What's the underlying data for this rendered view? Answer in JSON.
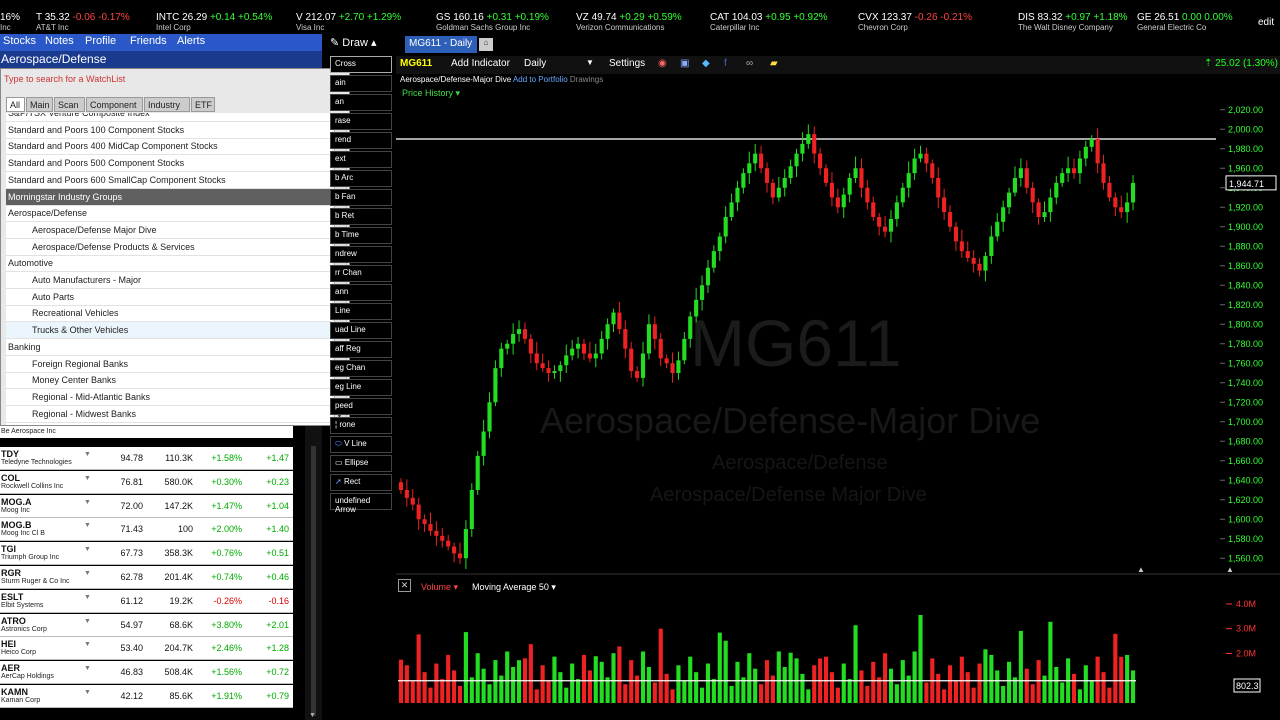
{
  "ticker": [
    {
      "sym": "16%",
      "price": "",
      "chg": "",
      "pct": "",
      "dir": "",
      "name": ""
    },
    {
      "sym": "T",
      "price": "35.32",
      "chg": "-0.06",
      "pct": "-0.17%",
      "dir": "dn",
      "name": "AT&T Inc"
    },
    {
      "sym": "INTC",
      "price": "26.29",
      "chg": "+0.14",
      "pct": "+0.54%",
      "dir": "up",
      "name": "Intel Corp"
    },
    {
      "sym": "V",
      "price": "212.07",
      "chg": "+2.70",
      "pct": "+1.29%",
      "dir": "up",
      "name": "Visa Inc"
    },
    {
      "sym": "GS",
      "price": "160.16",
      "chg": "+0.31",
      "pct": "+0.19%",
      "dir": "up",
      "name": "Goldman Sachs Group Inc"
    },
    {
      "sym": "VZ",
      "price": "49.74",
      "chg": "+0.29",
      "pct": "+0.59%",
      "dir": "up",
      "name": "Verizon Communications"
    },
    {
      "sym": "CAT",
      "price": "104.03",
      "chg": "+0.95",
      "pct": "+0.92%",
      "dir": "up",
      "name": "Caterpillar Inc"
    },
    {
      "sym": "CVX",
      "price": "123.37",
      "chg": "-0.26",
      "pct": "-0.21%",
      "dir": "dn",
      "name": "Chevron Corp"
    },
    {
      "sym": "DIS",
      "price": "83.32",
      "chg": "+0.97",
      "pct": "+1.18%",
      "dir": "up",
      "name": "The Walt Disney Company"
    },
    {
      "sym": "GE",
      "price": "26.51",
      "chg": "0.00",
      "pct": "0.00%",
      "dir": "up",
      "name": "General Electric Co"
    }
  ],
  "edit": "edit",
  "first_name": "Inc",
  "nav": [
    "Stocks",
    "Notes",
    "Profile",
    "Friends",
    "Alerts"
  ],
  "watchlist_title": "Aerospace/Defense",
  "popup": {
    "search_placeholder": "Type to search for a WatchList",
    "tabs": [
      "All",
      "Main",
      "Scan",
      "Component",
      "Industry",
      "ETF"
    ],
    "items": [
      {
        "label": "S&P/TSX Venture Composite Index",
        "type": "item"
      },
      {
        "label": "Standard and Poors 100 Component Stocks",
        "type": "item"
      },
      {
        "label": "Standard and Poors 400 MidCap Component Stocks",
        "type": "item"
      },
      {
        "label": "Standard and Poors 500 Component Stocks",
        "type": "item"
      },
      {
        "label": "Standard and Poors 600 SmallCap Component Stocks",
        "type": "item"
      },
      {
        "label": "Morningstar Industry Groups",
        "type": "hdr"
      },
      {
        "label": "Aerospace/Defense",
        "type": "item"
      },
      {
        "label": "Aerospace/Defense Major Dive",
        "type": "sub"
      },
      {
        "label": "Aerospace/Defense Products & Services",
        "type": "sub"
      },
      {
        "label": "Automotive",
        "type": "item"
      },
      {
        "label": "Auto Manufacturers - Major",
        "type": "sub"
      },
      {
        "label": "Auto Parts",
        "type": "sub"
      },
      {
        "label": "Recreational Vehicles",
        "type": "sub"
      },
      {
        "label": "Trucks & Other Vehicles",
        "type": "sel"
      },
      {
        "label": "Banking",
        "type": "item"
      },
      {
        "label": "Foreign Regional Banks",
        "type": "sub"
      },
      {
        "label": "Money Center Banks",
        "type": "sub"
      },
      {
        "label": "Regional - Mid-Atlantic Banks",
        "type": "sub"
      },
      {
        "label": "Regional - Midwest Banks",
        "type": "sub"
      }
    ]
  },
  "watchlist_top_name": "Be Aerospace Inc",
  "watchlist": [
    {
      "sym": "TDY",
      "name": "Teledyne Technologies",
      "price": "94.78",
      "vol": "110.3K",
      "pct": "+1.58%",
      "chg": "+1.47",
      "dir": "pos"
    },
    {
      "sym": "COL",
      "name": "Rockwell Collins Inc",
      "price": "76.81",
      "vol": "580.0K",
      "pct": "+0.30%",
      "chg": "+0.23",
      "dir": "pos"
    },
    {
      "sym": "MOG.A",
      "name": "Moog Inc",
      "price": "72.00",
      "vol": "147.2K",
      "pct": "+1.47%",
      "chg": "+1.04",
      "dir": "pos"
    },
    {
      "sym": "MOG.B",
      "name": "Moog Inc Cl B",
      "price": "71.43",
      "vol": "100",
      "pct": "+2.00%",
      "chg": "+1.40",
      "dir": "pos"
    },
    {
      "sym": "TGI",
      "name": "Triumph Group Inc",
      "price": "67.73",
      "vol": "358.3K",
      "pct": "+0.76%",
      "chg": "+0.51",
      "dir": "pos"
    },
    {
      "sym": "RGR",
      "name": "Sturm Ruger & Co Inc",
      "price": "62.78",
      "vol": "201.4K",
      "pct": "+0.74%",
      "chg": "+0.46",
      "dir": "pos"
    },
    {
      "sym": "ESLT",
      "name": "Elbit Systems",
      "price": "61.12",
      "vol": "19.2K",
      "pct": "-0.26%",
      "chg": "-0.16",
      "dir": "neg"
    },
    {
      "sym": "ATRO",
      "name": "Astronics Corp",
      "price": "54.97",
      "vol": "68.6K",
      "pct": "+3.80%",
      "chg": "+2.01",
      "dir": "pos"
    },
    {
      "sym": "HEI",
      "name": "Heico Corp",
      "price": "53.40",
      "vol": "204.7K",
      "pct": "+2.46%",
      "chg": "+1.28",
      "dir": "pos"
    },
    {
      "sym": "AER",
      "name": "AerCap Holdings",
      "price": "46.83",
      "vol": "508.4K",
      "pct": "+1.56%",
      "chg": "+0.72",
      "dir": "pos"
    },
    {
      "sym": "KAMN",
      "name": "Kaman Corp",
      "price": "42.12",
      "vol": "85.6K",
      "pct": "+1.91%",
      "chg": "+0.79",
      "dir": "pos"
    }
  ],
  "draw_label": "Draw",
  "tools": [
    "Cross",
    "Pan",
    "Erase",
    "Trend",
    "Text",
    "Fib Arc",
    "Fib Fan",
    "Fib Ret",
    "Fib Time",
    "Andrew",
    "Curr Chan",
    "Gann",
    "H Line",
    "Quad Line",
    "Raff Reg",
    "Reg Chan",
    "Reg Line",
    "Speed",
    "Tirone",
    "V Line",
    "Ellipse",
    "Rect",
    "Arrow"
  ],
  "tools_partial": [
    "Cross",
    "ain",
    "an",
    "rase",
    "rend",
    "ext",
    "b Arc",
    "b Fan",
    "b Ret",
    "b Time",
    "ndrew",
    "rr Chan",
    "ann",
    "Line",
    "uad Line",
    "aff Reg",
    "eg Chan",
    "eg Line",
    "peed",
    "rone",
    "V Line",
    "Ellipse",
    "Rect",
    "Arrow"
  ],
  "chart": {
    "tab": "MG611 - Daily",
    "symbol": "MG611",
    "add_indicator": "Add Indicator",
    "period": "Daily",
    "settings": "Settings",
    "change": "25.02 (1.30%)",
    "subtitle": "Aerospace/Defense-Major Dive",
    "add_portfolio": "Add to Portfolio",
    "drawings": "Drawings",
    "price_history": "Price History",
    "wm1": "MG611",
    "wm2": "Aerospace/Defense-Major Dive",
    "wm3": "Aerospace/Defense",
    "wm4": "Aerospace/Defense Major Dive",
    "current_price": "1,944.71",
    "volume_label": "Volume",
    "ma_label": "Moving Average 50",
    "vol_current": "802.3"
  },
  "chart_data": {
    "type": "candlestick",
    "ylim": [
      1550,
      2030
    ],
    "yticks": [
      "2,020.00",
      "2,000.00",
      "1,980.00",
      "1,960.00",
      "1,940.00",
      "1,920.00",
      "1,900.00",
      "1,880.00",
      "1,860.00",
      "1,840.00",
      "1,820.00",
      "1,800.00",
      "1,780.00",
      "1,760.00",
      "1,740.00",
      "1,720.00",
      "1,700.00",
      "1,680.00",
      "1,660.00",
      "1,640.00",
      "1,620.00",
      "1,600.00",
      "1,580.00",
      "1,560.00"
    ],
    "hline": 1990,
    "closes": [
      1630,
      1622,
      1615,
      1600,
      1595,
      1588,
      1583,
      1578,
      1572,
      1565,
      1560,
      1590,
      1630,
      1665,
      1690,
      1720,
      1755,
      1775,
      1780,
      1790,
      1795,
      1785,
      1770,
      1760,
      1755,
      1750,
      1752,
      1758,
      1768,
      1775,
      1780,
      1770,
      1765,
      1770,
      1785,
      1800,
      1812,
      1795,
      1775,
      1752,
      1745,
      1770,
      1800,
      1785,
      1765,
      1760,
      1750,
      1763,
      1785,
      1808,
      1825,
      1840,
      1858,
      1875,
      1890,
      1910,
      1925,
      1940,
      1955,
      1965,
      1975,
      1960,
      1945,
      1930,
      1940,
      1950,
      1962,
      1975,
      1985,
      1995,
      1975,
      1960,
      1945,
      1930,
      1920,
      1933,
      1950,
      1960,
      1940,
      1925,
      1910,
      1900,
      1895,
      1908,
      1925,
      1940,
      1955,
      1970,
      1975,
      1965,
      1950,
      1930,
      1915,
      1900,
      1885,
      1875,
      1868,
      1862,
      1855,
      1870,
      1890,
      1905,
      1920,
      1935,
      1950,
      1960,
      1940,
      1925,
      1910,
      1915,
      1930,
      1945,
      1955,
      1960,
      1955,
      1970,
      1982,
      1990,
      1965,
      1945,
      1930,
      1920,
      1915,
      1925,
      1945
    ],
    "volume_max_m": 4.2,
    "vol_ticks": [
      "4.0M",
      "3.0M",
      "2.0M"
    ],
    "ma50_m": 0.9
  }
}
